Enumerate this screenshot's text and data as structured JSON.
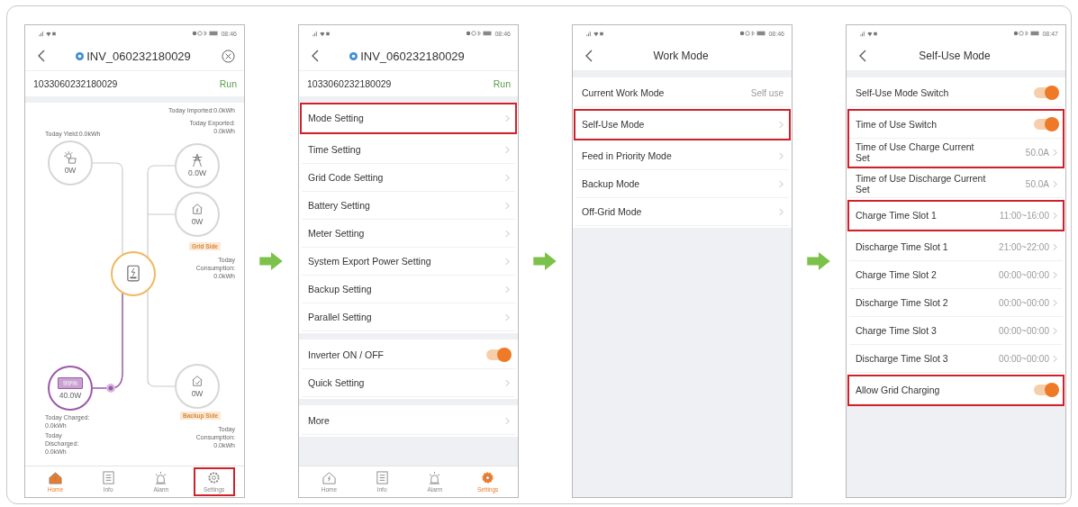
{
  "screens": [
    {
      "status_time": "08:46",
      "header": {
        "kind": "device",
        "title": "INV_060232180029",
        "close": true
      },
      "device": {
        "serial": "1033060232180029",
        "status": "Run"
      },
      "body": {
        "kind": "flow",
        "flow": {
          "today_imported": "Today Imported:0.0kWh",
          "today_exported": "Today Exported: 0.0kWh",
          "today_yield": "Today Yield:0.0kWh",
          "solar": "0W",
          "grid": "0.0W",
          "grid_load": "0W",
          "grid_side": "Grid Side",
          "grid_consumption": "Today Consumption: 0.0kWh",
          "battery_percent": "99%",
          "battery": "40.0W",
          "today_charged": "Today Charged: 0.0kWh",
          "today_discharged": "Today Discharged: 0.0kWh",
          "backup_load": "0W",
          "backup_side": "Backup Side",
          "backup_consumption": "Today Consumption: 0.0kWh"
        }
      },
      "nav": [
        {
          "label": "Home",
          "selected": true,
          "highlighted": false
        },
        {
          "label": "Info",
          "selected": false,
          "highlighted": false
        },
        {
          "label": "Alarm",
          "selected": false,
          "highlighted": false
        },
        {
          "label": "Settings",
          "selected": false,
          "highlighted": true
        }
      ]
    },
    {
      "status_time": "08:46",
      "header": {
        "kind": "device",
        "title": "INV_060232180029",
        "close": false
      },
      "device": {
        "serial": "1033060232180029",
        "status": "Run"
      },
      "body": {
        "kind": "list",
        "sections": [
          {
            "groups": [
              {
                "highlighted": true,
                "rows": [
                  {
                    "kind": "link",
                    "label": "Mode Setting"
                  }
                ]
              },
              {
                "highlighted": false,
                "rows": [
                  {
                    "kind": "link",
                    "label": "Time Setting"
                  },
                  {
                    "kind": "link",
                    "label": "Grid Code Setting"
                  },
                  {
                    "kind": "link",
                    "label": "Battery Setting"
                  },
                  {
                    "kind": "link",
                    "label": "Meter Setting"
                  },
                  {
                    "kind": "link",
                    "label": "System Export Power Setting"
                  },
                  {
                    "kind": "link",
                    "label": "Backup Setting"
                  },
                  {
                    "kind": "link",
                    "label": "Parallel Setting"
                  }
                ]
              }
            ]
          },
          {
            "groups": [
              {
                "highlighted": false,
                "rows": [
                  {
                    "kind": "toggle",
                    "label": "Inverter ON / OFF",
                    "on": true
                  },
                  {
                    "kind": "link",
                    "label": "Quick Setting"
                  }
                ]
              }
            ]
          },
          {
            "groups": [
              {
                "highlighted": false,
                "rows": [
                  {
                    "kind": "link",
                    "label": "More"
                  }
                ]
              }
            ]
          }
        ]
      },
      "nav": [
        {
          "label": "Home",
          "selected": false,
          "highlighted": false
        },
        {
          "label": "Info",
          "selected": false,
          "highlighted": false
        },
        {
          "label": "Alarm",
          "selected": false,
          "highlighted": false
        },
        {
          "label": "Settings",
          "selected": true,
          "highlighted": false
        }
      ]
    },
    {
      "status_time": "08:46",
      "header": {
        "kind": "plain",
        "title": "Work Mode",
        "close": false
      },
      "body": {
        "kind": "list",
        "sections": [
          {
            "groups": [
              {
                "highlighted": false,
                "rows": [
                  {
                    "kind": "value",
                    "label": "Current Work Mode",
                    "value": "Self use"
                  }
                ]
              },
              {
                "highlighted": true,
                "rows": [
                  {
                    "kind": "link",
                    "label": "Self-Use Mode"
                  }
                ]
              },
              {
                "highlighted": false,
                "rows": [
                  {
                    "kind": "link",
                    "label": "Feed in Priority Mode"
                  },
                  {
                    "kind": "link",
                    "label": "Backup Mode"
                  },
                  {
                    "kind": "link",
                    "label": "Off-Grid Mode"
                  }
                ]
              }
            ]
          }
        ]
      }
    },
    {
      "status_time": "08:47",
      "header": {
        "kind": "plain",
        "title": "Self-Use Mode",
        "close": false
      },
      "body": {
        "kind": "list",
        "sections": [
          {
            "groups": [
              {
                "highlighted": false,
                "rows": [
                  {
                    "kind": "toggle",
                    "label": "Self-Use Mode Switch",
                    "on": true
                  }
                ]
              },
              {
                "highlighted": true,
                "rows": [
                  {
                    "kind": "toggle",
                    "label": "Time of Use Switch",
                    "on": true
                  },
                  {
                    "kind": "link",
                    "label": "Time of Use Charge Current Set",
                    "value": "50.0A"
                  }
                ]
              },
              {
                "highlighted": false,
                "rows": [
                  {
                    "kind": "link",
                    "label": "Time of Use Discharge Current Set",
                    "value": "50.0A"
                  }
                ]
              },
              {
                "highlighted": true,
                "rows": [
                  {
                    "kind": "link",
                    "label": "Charge Time Slot 1",
                    "value": "11:00~16:00"
                  }
                ]
              },
              {
                "highlighted": false,
                "rows": [
                  {
                    "kind": "link",
                    "label": "Discharge Time Slot 1",
                    "value": "21:00~22:00"
                  },
                  {
                    "kind": "link",
                    "label": "Charge Time Slot 2",
                    "value": "00:00~00:00"
                  },
                  {
                    "kind": "link",
                    "label": "Discharge Time Slot 2",
                    "value": "00:00~00:00"
                  },
                  {
                    "kind": "link",
                    "label": "Charge Time Slot 3",
                    "value": "00:00~00:00"
                  },
                  {
                    "kind": "link",
                    "label": "Discharge Time Slot 3",
                    "value": "00:00~00:00"
                  }
                ]
              },
              {
                "highlighted": true,
                "rows": [
                  {
                    "kind": "toggle",
                    "label": "Allow Grid Charging",
                    "on": true
                  }
                ]
              }
            ]
          }
        ]
      }
    }
  ]
}
